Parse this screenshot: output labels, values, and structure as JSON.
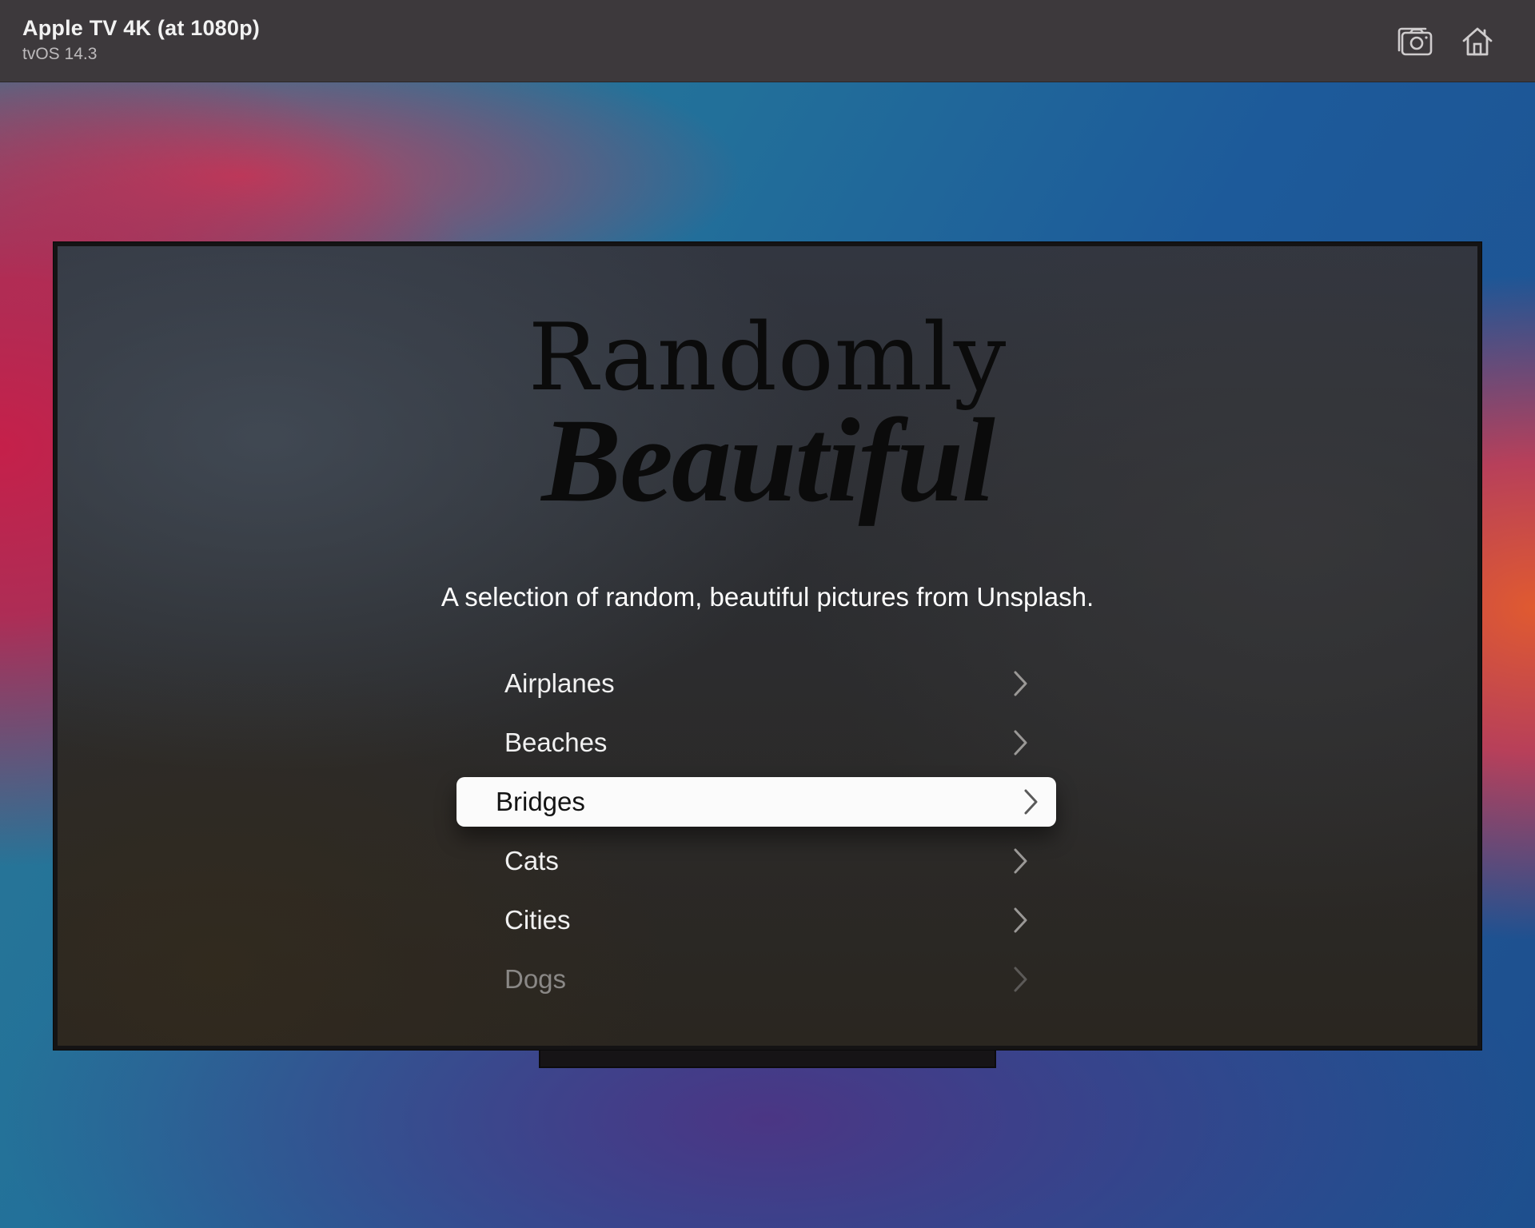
{
  "titlebar": {
    "device_name": "Apple TV 4K (at 1080p)",
    "os_version": "tvOS 14.3",
    "screenshot_icon": "camera-icon",
    "home_icon": "home-icon"
  },
  "app": {
    "logo_line1": "Randomly",
    "logo_line2": "Beautiful",
    "subtitle": "A selection of random, beautiful pictures from Unsplash."
  },
  "menu": {
    "items": [
      {
        "label": "Airplanes",
        "state": "normal"
      },
      {
        "label": "Beaches",
        "state": "normal"
      },
      {
        "label": "Bridges",
        "state": "focused"
      },
      {
        "label": "Cats",
        "state": "normal"
      },
      {
        "label": "Cities",
        "state": "normal"
      },
      {
        "label": "Dogs",
        "state": "dimmed"
      }
    ],
    "chevron_icon": "chevron-right-icon"
  },
  "colors": {
    "titlebar_bg": "#3d393c",
    "focus_bg": "#fbfbfb",
    "menu_text": "#f1f1f1"
  }
}
